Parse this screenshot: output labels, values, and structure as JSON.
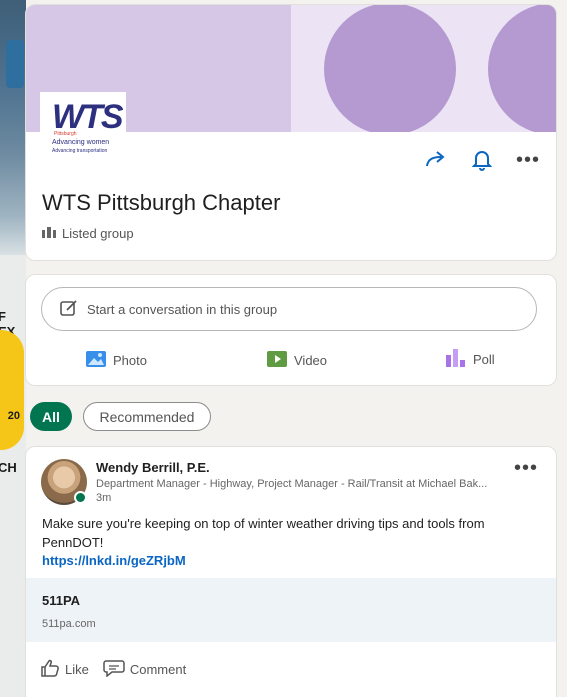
{
  "colors": {
    "accent": "#0a66c2",
    "green": "#01754f",
    "cover": "#d7c7e6",
    "circle": "#b49ad1"
  },
  "group": {
    "logo_text": "WTS",
    "logo_sub1": "Pittsburgh",
    "logo_sub2": "Advancing women",
    "logo_sub3": "Advancing transportation",
    "title": "WTS Pittsburgh Chapter",
    "type_label": "Listed group"
  },
  "composer": {
    "placeholder": "Start a conversation in this group",
    "photo": "Photo",
    "video": "Video",
    "poll": "Poll"
  },
  "filters": {
    "all": "All",
    "recommended": "Recommended"
  },
  "post": {
    "author": "Wendy Berrill, P.E.",
    "subtitle": "Department Manager - Highway, Project Manager - Rail/Transit at Michael Bak...",
    "time": "3m",
    "body": "Make sure you're keeping on top of winter weather driving tips and tools from PennDOT!",
    "link": "https://lnkd.in/geZRjbM",
    "preview_title": "511PA",
    "preview_domain": "511pa.com",
    "like": "Like",
    "comment": "Comment"
  },
  "background": {
    "frag1": "F EX",
    "frag2": "20",
    "frag3": "CH"
  }
}
